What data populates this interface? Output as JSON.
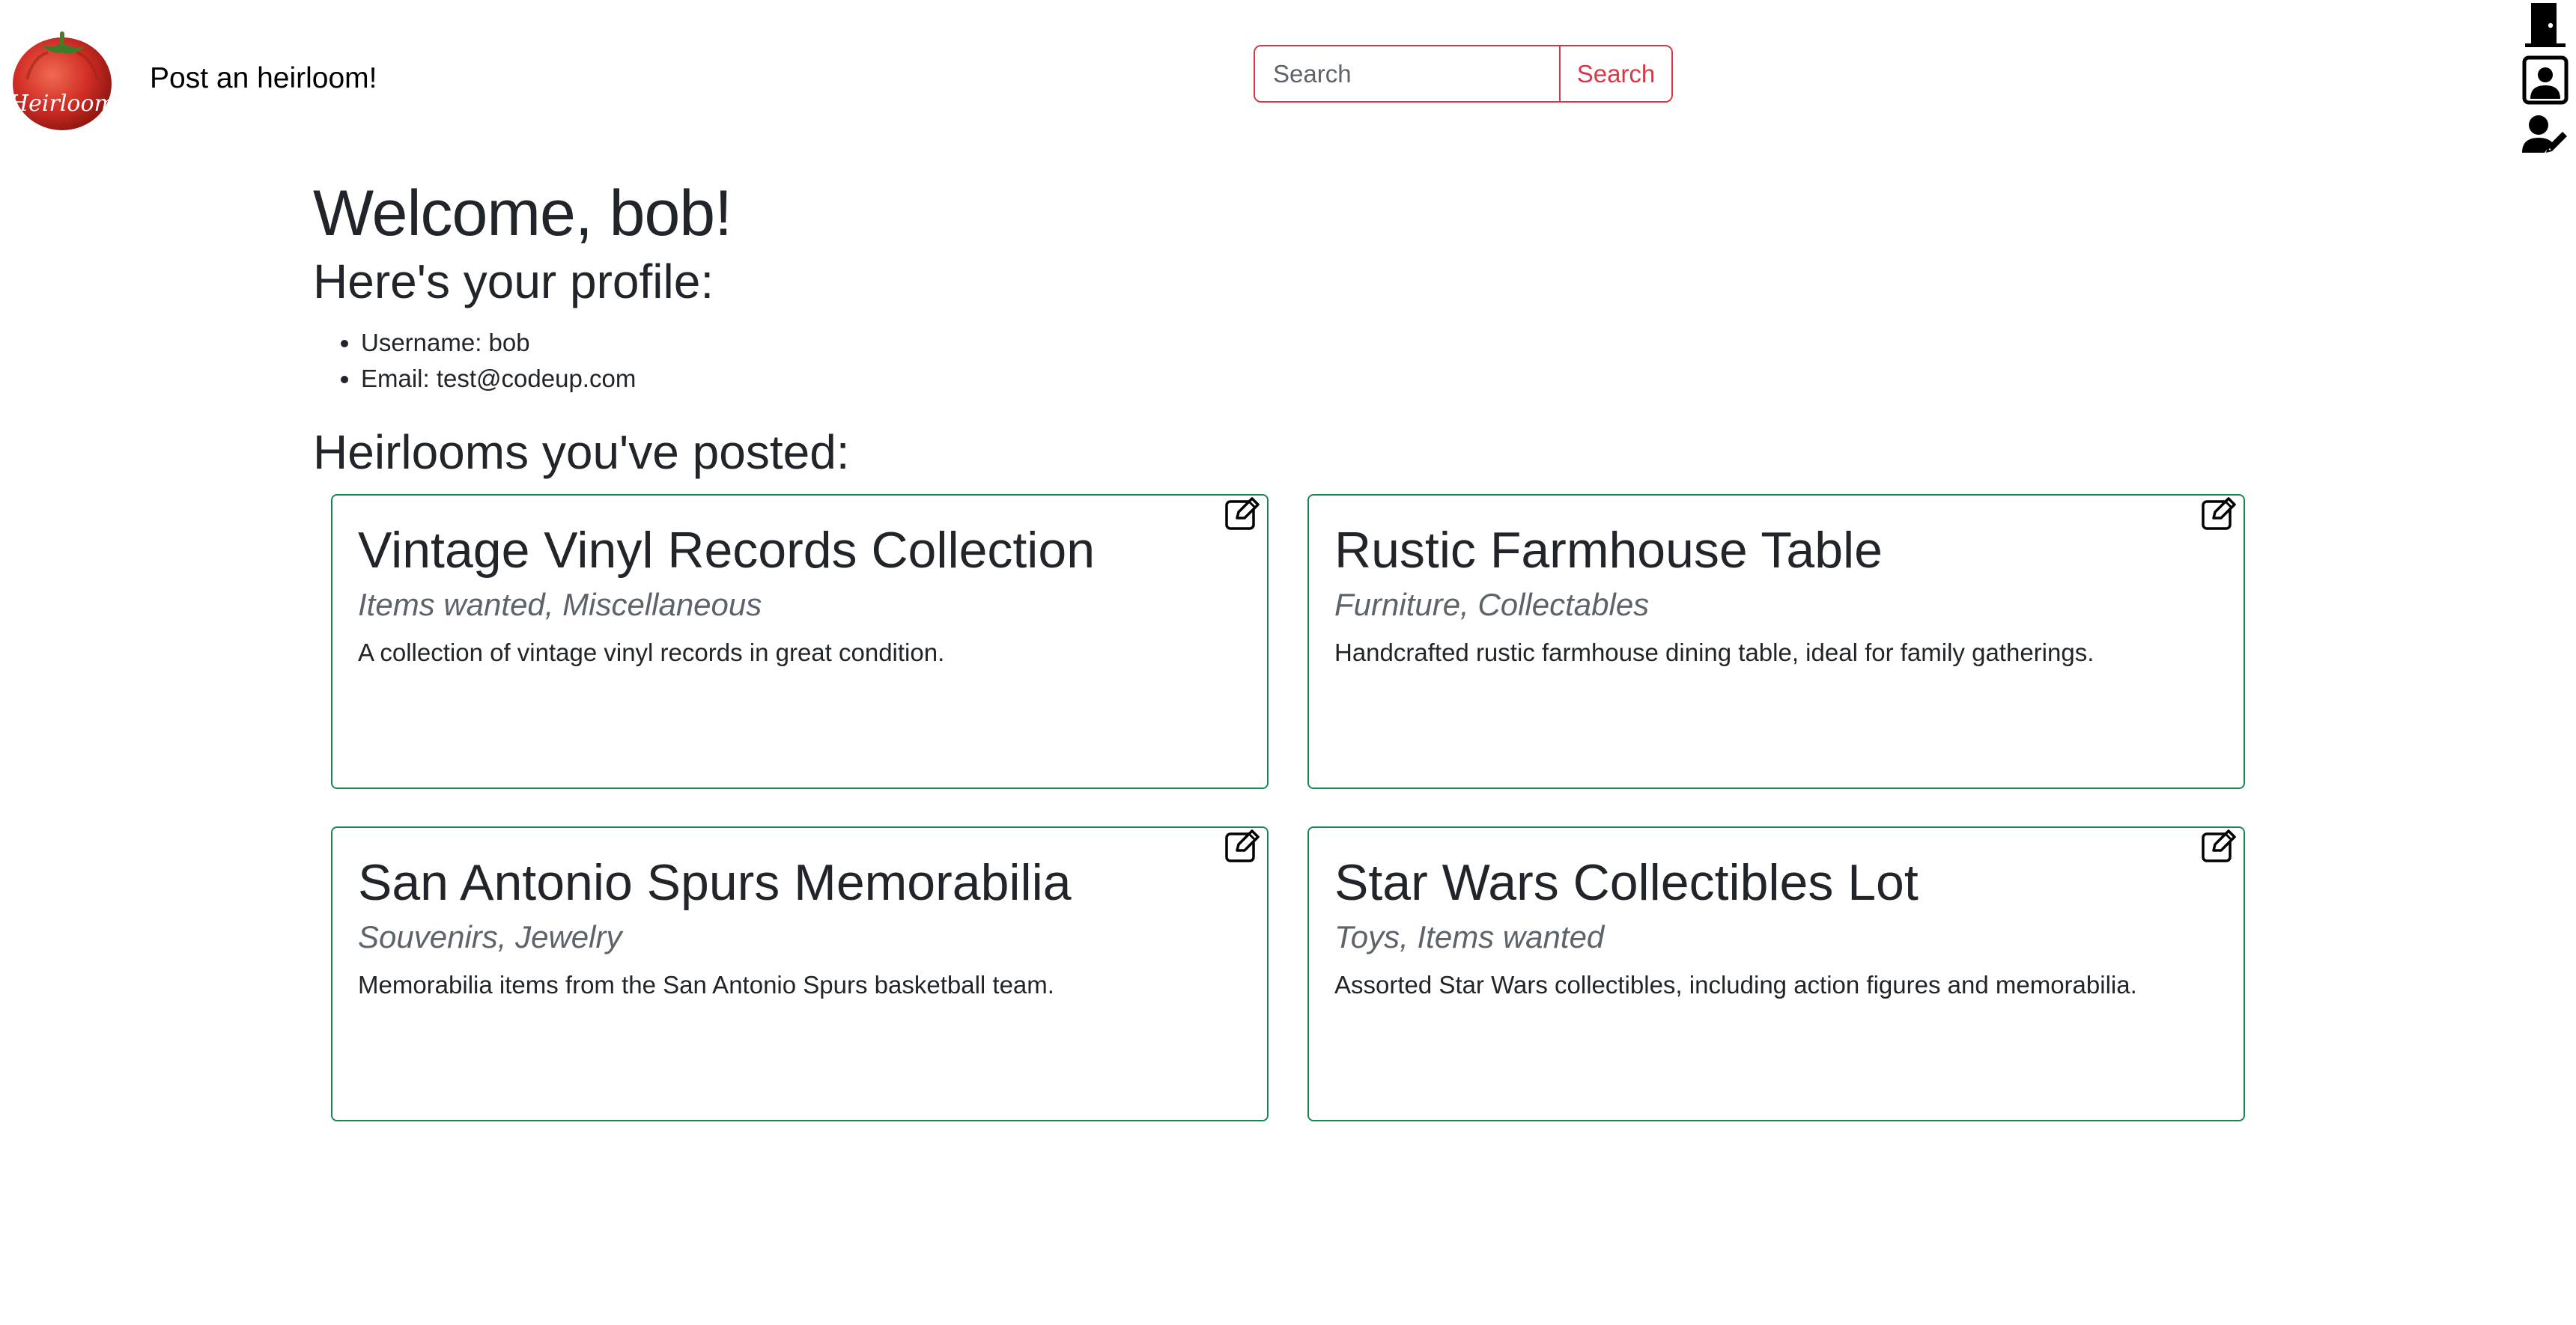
{
  "header": {
    "post_link": "Post an heirloom!",
    "logo_text": "Heirloom"
  },
  "search": {
    "placeholder": "Search",
    "button_label": "Search"
  },
  "side_icons": [
    "door-icon",
    "user-profile-icon",
    "user-edit-icon"
  ],
  "profile": {
    "welcome": "Welcome, bob!",
    "heading": "Here's your profile:",
    "username_item": "Username: bob",
    "email_item": "Email: test@codeup.com"
  },
  "heirlooms": {
    "heading": "Heirlooms you've posted:",
    "items": [
      {
        "title": "Vintage Vinyl Records Collection",
        "categories": "Items wanted, Miscellaneous",
        "description": "A collection of vintage vinyl records in great condition."
      },
      {
        "title": "Rustic Farmhouse Table",
        "categories": "Furniture, Collectables",
        "description": "Handcrafted rustic farmhouse dining table, ideal for family gatherings."
      },
      {
        "title": "San Antonio Spurs Memorabilia",
        "categories": "Souvenirs, Jewelry",
        "description": "Memorabilia items from the San Antonio Spurs basketball team."
      },
      {
        "title": "Star Wars Collectibles Lot",
        "categories": "Toys, Items wanted",
        "description": "Assorted Star Wars collectibles, including action figures and memorabilia."
      }
    ]
  },
  "colors": {
    "search_accent": "#dc3545",
    "card_border": "#198754",
    "muted_text": "#5c636a"
  }
}
